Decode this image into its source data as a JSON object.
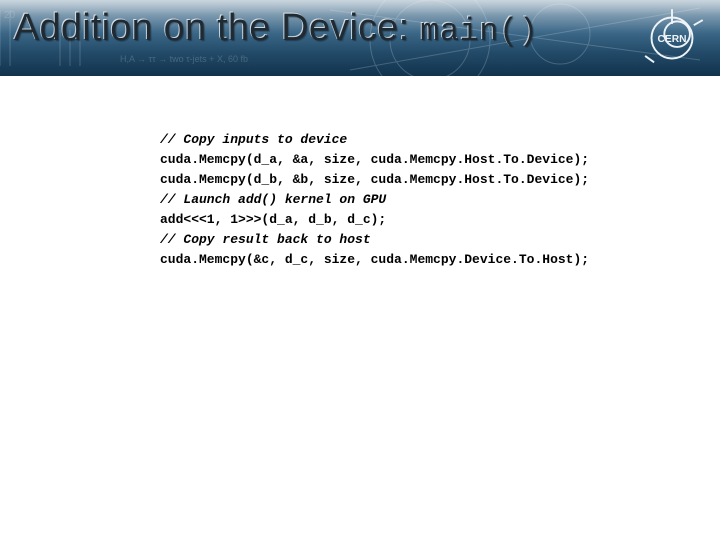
{
  "header": {
    "title_plain": "Addition on the Device: ",
    "title_mono": "main()",
    "logo_label": "CERN"
  },
  "code": {
    "lines": [
      {
        "kind": "cmt",
        "text": "// Copy inputs to device"
      },
      {
        "kind": "stmt",
        "text": "cuda.Memcpy(d_a, &a, size, cuda.Memcpy.Host.To.Device);"
      },
      {
        "kind": "stmt",
        "text": "cuda.Memcpy(d_b, &b, size, cuda.Memcpy.Host.To.Device);"
      },
      {
        "kind": "cmt",
        "text": "// Launch add() kernel on GPU"
      },
      {
        "kind": "stmt",
        "text": "add<<<1, 1>>>(d_a, d_b, d_c);"
      },
      {
        "kind": "cmt",
        "text": "// Copy result back to host"
      },
      {
        "kind": "stmt",
        "text": "cuda.Memcpy(&c, d_c, size, cuda.Memcpy.Device.To.Host);"
      }
    ]
  }
}
